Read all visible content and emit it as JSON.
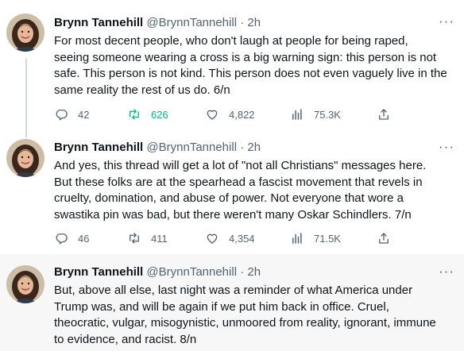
{
  "colors": {
    "text": "#0f1419",
    "muted": "#536471",
    "retweet_active": "#00ba7c",
    "rail": "#cfd9de",
    "highlight_bg": "#f7f7f7"
  },
  "tweets": [
    {
      "author": "Brynn Tannehill",
      "handle": "@BrynnTannehill",
      "time": "· 2h",
      "text": "For most decent people, who don't laugh at people for being raped,\nseeing someone wearing a cross is a big warning sign: this person is not\nsafe. This person is not kind. This person does not even vaguely live in the\nsame reality the rest of us do. 6/n",
      "replies": "42",
      "retweets": "626",
      "retweeted": true,
      "likes": "4,822",
      "views": "75.3K"
    },
    {
      "author": "Brynn Tannehill",
      "handle": "@BrynnTannehill",
      "time": "· 2h",
      "text": "And yes, this thread will get a lot of \"not all Christians\" messages here.\nBut these folks are at the spearhead a fascist movement that revels in\ncruelty, domination, and abuse of power. Not everyone that wore a\nswastika pin was bad, but there weren't many Oskar Schindlers. 7/n",
      "replies": "46",
      "retweets": "411",
      "retweeted": false,
      "likes": "4,354",
      "views": "71.5K"
    },
    {
      "author": "Brynn Tannehill",
      "handle": "@BrynnTannehill",
      "time": "· 2h",
      "text": "But, above all else, last night was a reminder of what America under\nTrump was, and will be again if we put him back in office. Cruel,\ntheocratic, vulgar, misogynistic, unmoored from reality, ignorant, immune\nto evidence, and racist. 8/n"
    }
  ],
  "icons": {
    "reply": "reply-icon",
    "retweet": "retweet-icon",
    "like": "heart-icon",
    "views": "views-icon",
    "share": "share-icon",
    "more": "more-icon"
  }
}
